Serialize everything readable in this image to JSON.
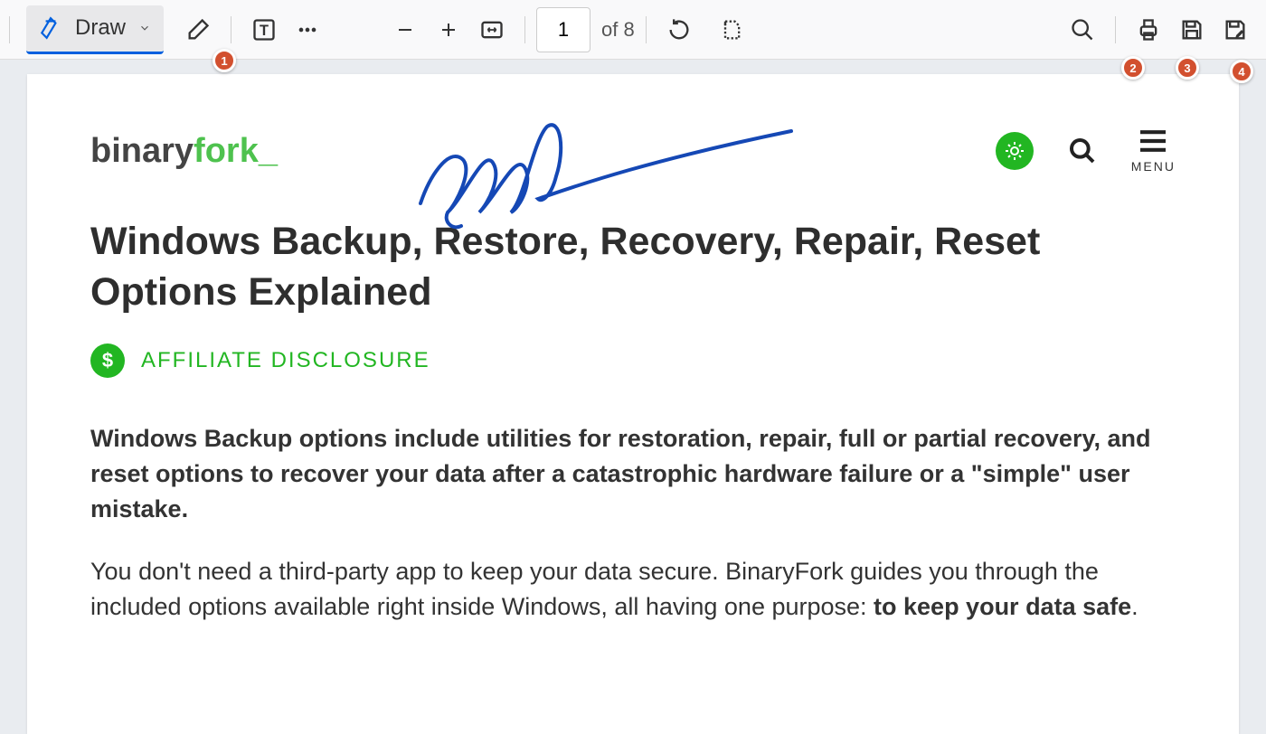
{
  "toolbar": {
    "draw_label": "Draw",
    "page_current": "1",
    "page_total": "of 8"
  },
  "page": {
    "logo": {
      "pre": "binary",
      "mid": "fork",
      "suffix": "_"
    },
    "menu_label": "MENU",
    "title": "Windows Backup, Restore, Recovery, Repair, Reset Options Explained",
    "affiliate_label": "AFFILIATE DISCLOSURE",
    "dollar": "$",
    "para1": "Windows Backup options include utilities for restoration, repair, full or partial recovery, and reset options to recover your data after a catastrophic hardware failure or a \"simple\" user mistake.",
    "para2_a": "You don't need a third-party app to keep your data secure. BinaryFork guides you through the included options available right inside Windows, all having one purpose: ",
    "para2_b": "to keep your data safe",
    "para2_c": "."
  },
  "annotations": {
    "1": "1",
    "2": "2",
    "3": "3",
    "4": "4"
  }
}
